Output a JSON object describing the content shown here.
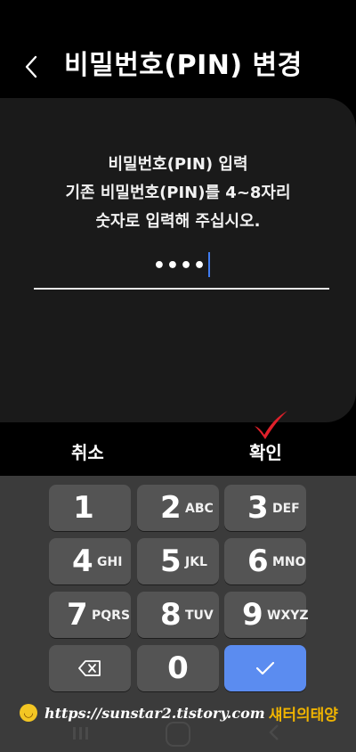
{
  "header": {
    "title": "비밀번호(PIN) 변경",
    "back_icon": "chevron-left-icon"
  },
  "dialog": {
    "heading": "비밀번호(PIN) 입력",
    "instruction_line1": "기존 비밀번호(PIN)를 4~8자리",
    "instruction_line2": "숫자로 입력해 주십시오.",
    "pin_value": "••••"
  },
  "actions": {
    "cancel_label": "취소",
    "ok_label": "확인"
  },
  "keypad": {
    "keys": [
      {
        "num": "1",
        "letters": ""
      },
      {
        "num": "2",
        "letters": "ABC"
      },
      {
        "num": "3",
        "letters": "DEF"
      },
      {
        "num": "4",
        "letters": "GHI"
      },
      {
        "num": "5",
        "letters": "JKL"
      },
      {
        "num": "6",
        "letters": "MNO"
      },
      {
        "num": "7",
        "letters": "PQRS"
      },
      {
        "num": "8",
        "letters": "TUV"
      },
      {
        "num": "9",
        "letters": "WXYZ"
      },
      {
        "num": "0",
        "letters": ""
      }
    ],
    "backspace_icon": "backspace-icon",
    "confirm_icon": "check-icon",
    "confirm_color": "#5b8cf0"
  },
  "watermark": {
    "url": "https://sunstar2.tistory.com",
    "name": "섀터의태양"
  },
  "colors": {
    "background": "#000000",
    "dialog_bg": "#1a1a1a",
    "keypad_bg": "#3b3b3b",
    "key_bg": "#545454",
    "cursor": "#3f7cf0",
    "annotation_check": "#e0202a"
  }
}
